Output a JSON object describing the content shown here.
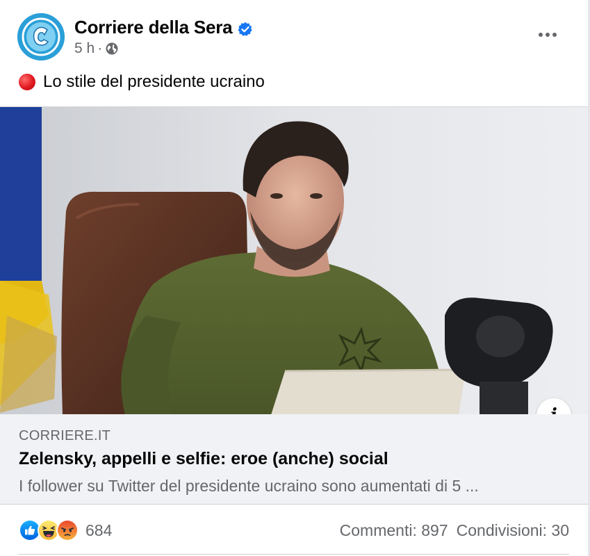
{
  "post": {
    "page_name": "Corriere della Sera",
    "verified": true,
    "time": "5 h",
    "separator": "·",
    "audience_icon": "globe-icon",
    "avatar_letter": "C",
    "text": "Lo stile del presidente ucraino",
    "text_prefix_icon": "red-circle-icon"
  },
  "link_preview": {
    "domain": "CORRIERE.IT",
    "title": "Zelensky, appelli e selfie: eroe (anche) social",
    "description": "I follower su Twitter del presidente ucraino sono aumentati di 5 ...",
    "info_label": "i"
  },
  "engagement": {
    "reaction_icons": [
      "like-icon",
      "haha-icon",
      "angry-icon"
    ],
    "reaction_count": "684",
    "comments": "Commenti: 897",
    "shares": "Condivisioni: 30"
  },
  "colors": {
    "brand": "#2a9fd8",
    "verified": "#1877f2",
    "secondary_text": "#65676b",
    "link_bg": "#f0f2f5"
  }
}
